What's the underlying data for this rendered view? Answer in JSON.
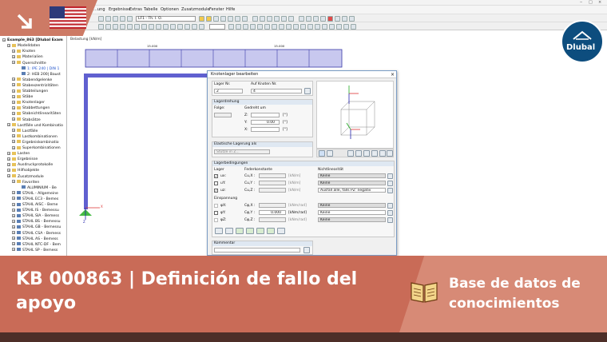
{
  "menu": {
    "items": [
      "…ung",
      "Ergebnisse",
      "Extras",
      "Tabelle",
      "Optionen",
      "Zusatzmodule",
      "Fenster",
      "Hilfe"
    ]
  },
  "toolbar": {
    "lf_combo": "LF1 - Th. I. O.",
    "banner_arrow": "arrow-down-right-icon"
  },
  "navigator": {
    "root": "Example_863 [Dlubal Exam",
    "items": [
      {
        "label": "Modelldaten",
        "level": 1,
        "icon": "folder"
      },
      {
        "label": "Knoten",
        "level": 2,
        "icon": "folder"
      },
      {
        "label": "Materialien",
        "level": 2,
        "icon": "folder"
      },
      {
        "label": "Querschnitte",
        "level": 2,
        "icon": "folder"
      },
      {
        "label": "1: IPE 240 | DIN 1",
        "level": 3,
        "icon": "item",
        "blue": true
      },
      {
        "label": "2: HEB 200| Baust",
        "level": 3,
        "icon": "item"
      },
      {
        "label": "Stabendgelenke",
        "level": 2,
        "icon": "folder"
      },
      {
        "label": "Stabexzentrizitäten",
        "level": 2,
        "icon": "folder"
      },
      {
        "label": "Stabteilungen",
        "level": 2,
        "icon": "folder"
      },
      {
        "label": "Stäbe",
        "level": 2,
        "icon": "folder"
      },
      {
        "label": "Knotenlager",
        "level": 2,
        "icon": "folder"
      },
      {
        "label": "Stabbettungen",
        "level": 2,
        "icon": "folder"
      },
      {
        "label": "Stabnichtlinearitäten",
        "level": 2,
        "icon": "folder"
      },
      {
        "label": "Stabsätze",
        "level": 2,
        "icon": "folder"
      },
      {
        "label": "Lastfälle und Kombinatio",
        "level": 1,
        "icon": "folder"
      },
      {
        "label": "Lastfälle",
        "level": 2,
        "icon": "folder"
      },
      {
        "label": "Lastkombinationen",
        "level": 2,
        "icon": "folder"
      },
      {
        "label": "Ergebniskombinatio",
        "level": 2,
        "icon": "folder"
      },
      {
        "label": "Superkombinationen",
        "level": 2,
        "icon": "folder"
      },
      {
        "label": "Lasten",
        "level": 1,
        "icon": "folder"
      },
      {
        "label": "Ergebnisse",
        "level": 1,
        "icon": "folder"
      },
      {
        "label": "Ausdruckprotokolle",
        "level": 1,
        "icon": "folder"
      },
      {
        "label": "Hilfsobjekte",
        "level": 1,
        "icon": "folder"
      },
      {
        "label": "Zusatzmodule",
        "level": 1,
        "icon": "folder"
      },
      {
        "label": "Favoriten",
        "level": 2,
        "icon": "folder"
      },
      {
        "label": "ALUMINIUM - Be",
        "level": 3,
        "icon": "item"
      },
      {
        "label": "STAHL - Allgemeine",
        "level": 2,
        "icon": "item"
      },
      {
        "label": "STAHL EC3 - Bemes",
        "level": 2,
        "icon": "item"
      },
      {
        "label": "STAHL AISC - Beme",
        "level": 2,
        "icon": "item"
      },
      {
        "label": "STAHL IS - Bemessu",
        "level": 2,
        "icon": "item"
      },
      {
        "label": "STAHL SIA - Bemess",
        "level": 2,
        "icon": "item"
      },
      {
        "label": "STAHL BS - Bemessu",
        "level": 2,
        "icon": "item"
      },
      {
        "label": "STAHL GB - Bemessu",
        "level": 2,
        "icon": "item"
      },
      {
        "label": "STAHL CSA - Bemess",
        "level": 2,
        "icon": "item"
      },
      {
        "label": "STAHL AS - Bemess",
        "level": 2,
        "icon": "item"
      },
      {
        "label": "STAHL NTC-DF - Bem",
        "level": 2,
        "icon": "item"
      },
      {
        "label": "STAHL SP - Bemess",
        "level": 2,
        "icon": "item"
      }
    ]
  },
  "canvas": {
    "legend": "Belastung [kN/m]",
    "load_label_1": "15.000",
    "load_label_2": "15.000",
    "axis_x": "X",
    "axis_z": "Z"
  },
  "dialog": {
    "title": "Knotenlager bearbeiten",
    "lager_nr_label": "Lager Nr.",
    "lager_nr_value": "2",
    "auf_knoten_label": "Auf Knoten Nr.",
    "auf_knoten_value": "4",
    "lagerdrehung_label": "Lagerdrehung",
    "folge_label": "Folge:",
    "gedreht_label": "Gedreht um",
    "rot_x_label": "Z:",
    "rot_y_label": "Y:",
    "rot_y_value": "0.00",
    "rot_z_label": "X:",
    "unit_deg": "[°]",
    "elastische_label": "Elastische Lagerung als",
    "stuetze_label": "Stütze in Z...",
    "bedingungen_label": "Lagerbedingungen",
    "lager_col": "Lager",
    "feder_col": "Federkonstante",
    "nichtlin_col": "Nichtlinearität",
    "ux_label": "ux:",
    "uy_label": "uY:",
    "uz_label": "uz:",
    "cux_label": "Cu,X :",
    "cuy_label": "Cu,Y :",
    "cuz_label": "Cu,Z :",
    "unit_kn_m": "[kN/m]",
    "einspannung_label": "Einspannung",
    "phix_label": "φX:",
    "phiy_label": "φY:",
    "phiz_label": "φZ:",
    "cphix_label": "Cφ,X :",
    "cphiy_label": "Cφ,Y :",
    "cphiy_value": "0.000",
    "cphiz_label": "Cφ,Z :",
    "unit_knm_rad": "[kNm/rad]",
    "keine": "Keine",
    "ausfall": "Ausfall alle, falls PZ' negativ",
    "kommentar_label": "Kommentar",
    "view_axis_x": "X",
    "view_axis_y": "Y",
    "view_axis_z": "Z"
  },
  "banner": {
    "title": "KB 000863 | Definición de fallo del apoyo",
    "kb_label": "Base de datos de conocimientos",
    "logo_text": "Dlubal",
    "book_icon": "open-book-icon"
  },
  "colors": {
    "banner_left": "#c96b57",
    "banner_right": "#d78a76",
    "bottom_strip": "#4d2e28",
    "dlubal_blue": "#0d4d7e",
    "member_blue": "#6060d0",
    "load_fill": "#c8c8ef"
  }
}
